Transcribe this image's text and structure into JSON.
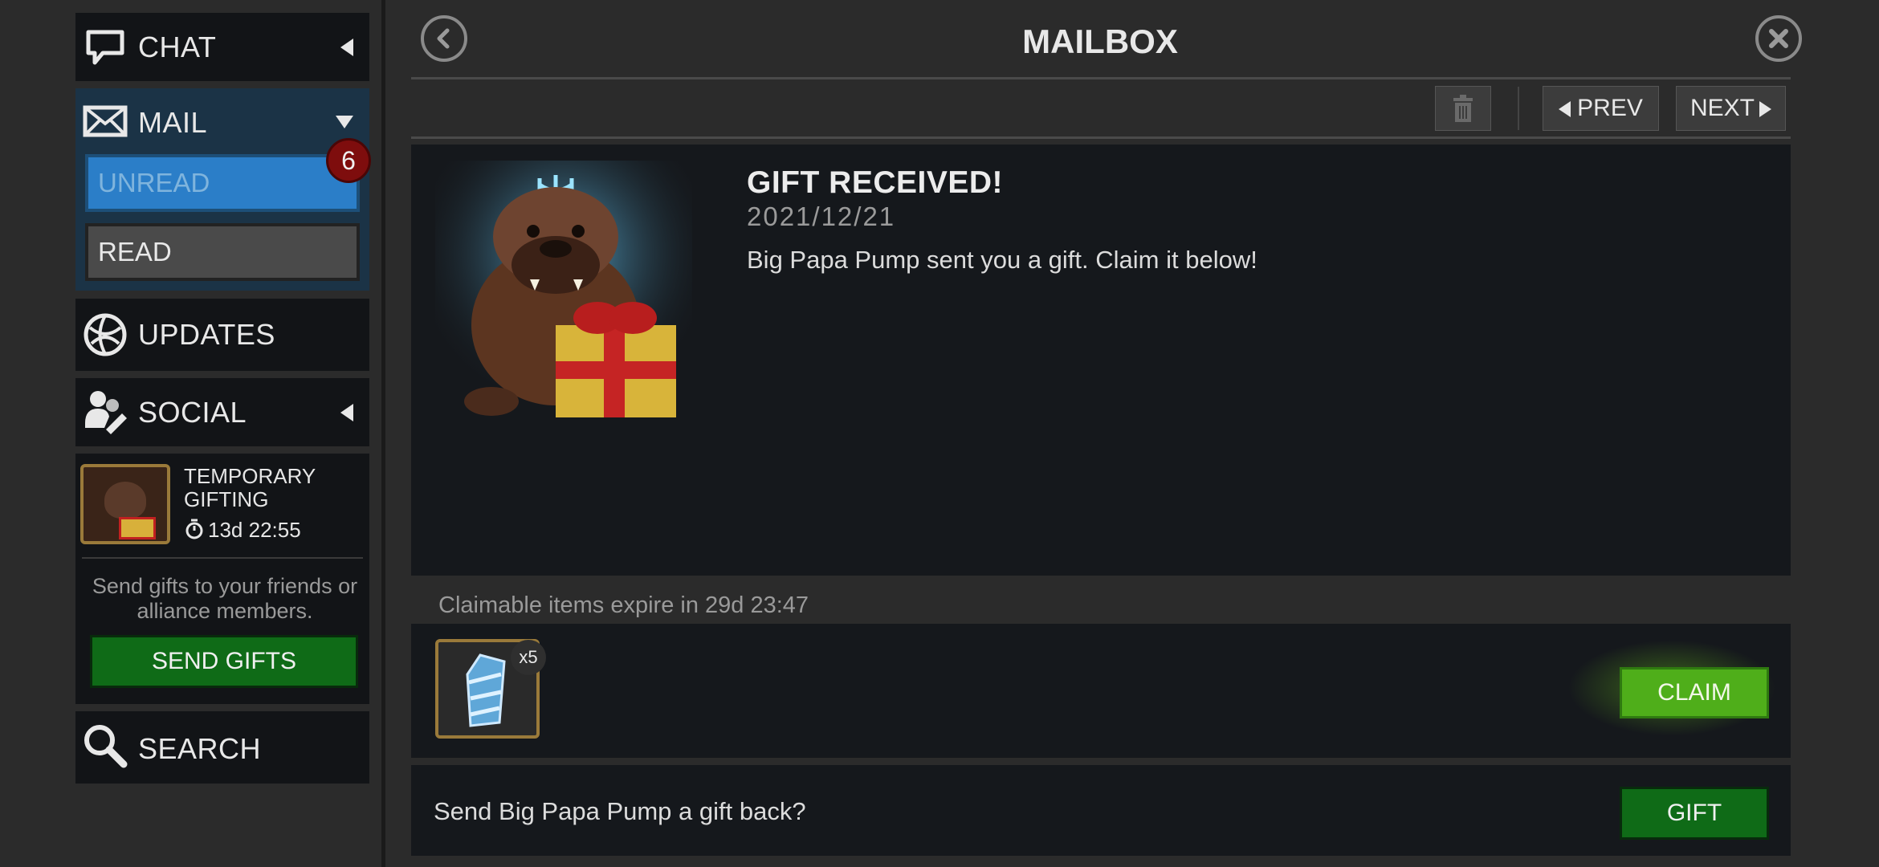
{
  "sidebar": {
    "chat_label": "CHAT",
    "mail_label": "MAIL",
    "unread_label": "UNREAD",
    "unread_count": "6",
    "read_label": "READ",
    "updates_label": "UPDATES",
    "social_label": "SOCIAL",
    "event": {
      "title": "TEMPORARY GIFTING",
      "timer": "13d 22:55",
      "description": "Send gifts to your friends or alliance members.",
      "button_label": "SEND GIFTS"
    },
    "search_label": "SEARCH"
  },
  "header": {
    "title": "MAILBOX"
  },
  "toolbar": {
    "prev_label": "PREV",
    "next_label": "NEXT"
  },
  "message": {
    "title": "GIFT RECEIVED!",
    "date": "2021/12/21",
    "body": "Big Papa Pump sent you a gift. Claim it below!"
  },
  "claim": {
    "expire_text": "Claimable items expire in 29d 23:47",
    "item_count": "x5",
    "claim_label": "CLAIM"
  },
  "gift_back": {
    "prompt": "Send Big Papa Pump a gift back?",
    "button_label": "GIFT"
  },
  "colors": {
    "unread_blue": "#2b7ec8",
    "claim_green": "#4fae1a",
    "badge_red": "#7e0d0d"
  }
}
